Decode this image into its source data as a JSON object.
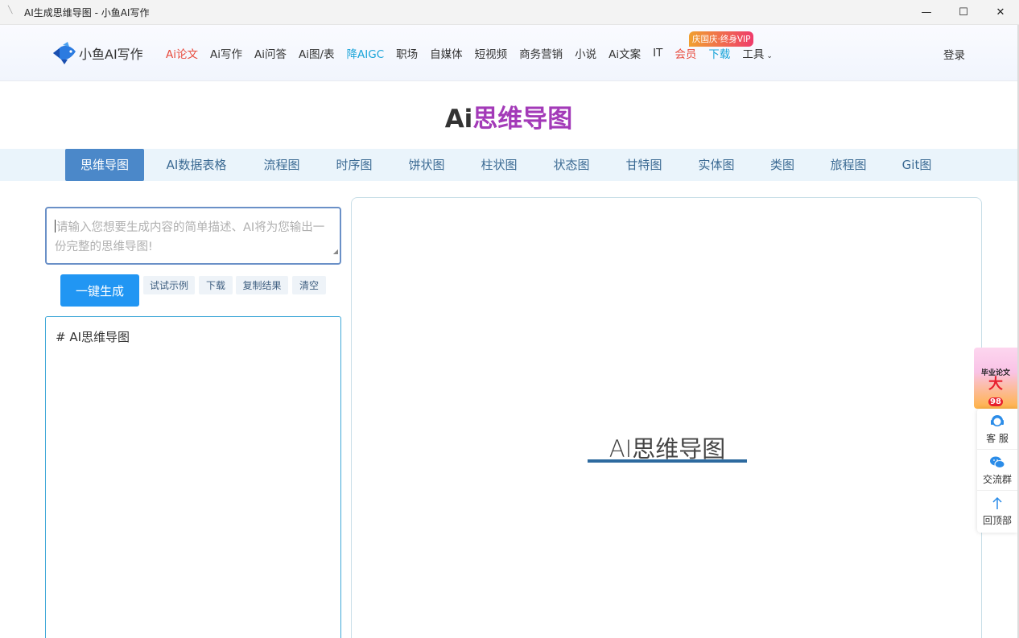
{
  "window": {
    "title": "AI生成思维导图 - 小鱼AI写作",
    "minimize": "—",
    "maximize": "☐",
    "close": "✕"
  },
  "nav": {
    "logo_text": "小鱼AI写作",
    "links": [
      {
        "label": "Ai论文",
        "color": "#e84a3c"
      },
      {
        "label": "Ai写作"
      },
      {
        "label": "Ai问答"
      },
      {
        "label": "Ai图/表"
      },
      {
        "label": "降AIGC",
        "color": "#1aa4d9"
      },
      {
        "label": "职场"
      },
      {
        "label": "自媒体"
      },
      {
        "label": "短视频"
      },
      {
        "label": "商务营销"
      },
      {
        "label": "小说"
      },
      {
        "label": "Ai文案"
      },
      {
        "label": "IT"
      },
      {
        "label": "会员",
        "color": "#e84a3c"
      },
      {
        "label": "下载",
        "color": "#1aa4d9"
      },
      {
        "label": "工具"
      }
    ],
    "vip_badge": "庆国庆·终身VIP",
    "login": "登录"
  },
  "heading": {
    "part_a": "Ai",
    "part_b": "思维导图"
  },
  "tabs": [
    {
      "label": "思维导图",
      "active": true
    },
    {
      "label": "AI数据表格"
    },
    {
      "label": "流程图"
    },
    {
      "label": "时序图"
    },
    {
      "label": "饼状图"
    },
    {
      "label": "柱状图"
    },
    {
      "label": "状态图"
    },
    {
      "label": "甘特图"
    },
    {
      "label": "实体图"
    },
    {
      "label": "类图"
    },
    {
      "label": "旅程图"
    },
    {
      "label": "Git图"
    }
  ],
  "prompt": {
    "placeholder": "请输入您想要生成内容的简单描述、AI将为您输出一份完整的思维导图!"
  },
  "actions": {
    "generate": "一键生成",
    "example": "试试示例",
    "download": "下载",
    "copy": "复制结果",
    "clear": "清空"
  },
  "editor": {
    "content": "# AI思维导图"
  },
  "preview": {
    "root_node": "AI思维导图"
  },
  "sidebar": {
    "promo_line1": "毕业论文",
    "promo_line2": "大",
    "promo_line3": "98",
    "customer_service": "客 服",
    "group": "交流群",
    "back_top": "回顶部"
  },
  "colors": {
    "accent": "#2196f3",
    "tab_active": "#4b88c9",
    "heading_purple": "#a33ab8",
    "mindmap_line": "#2d6a9f"
  }
}
